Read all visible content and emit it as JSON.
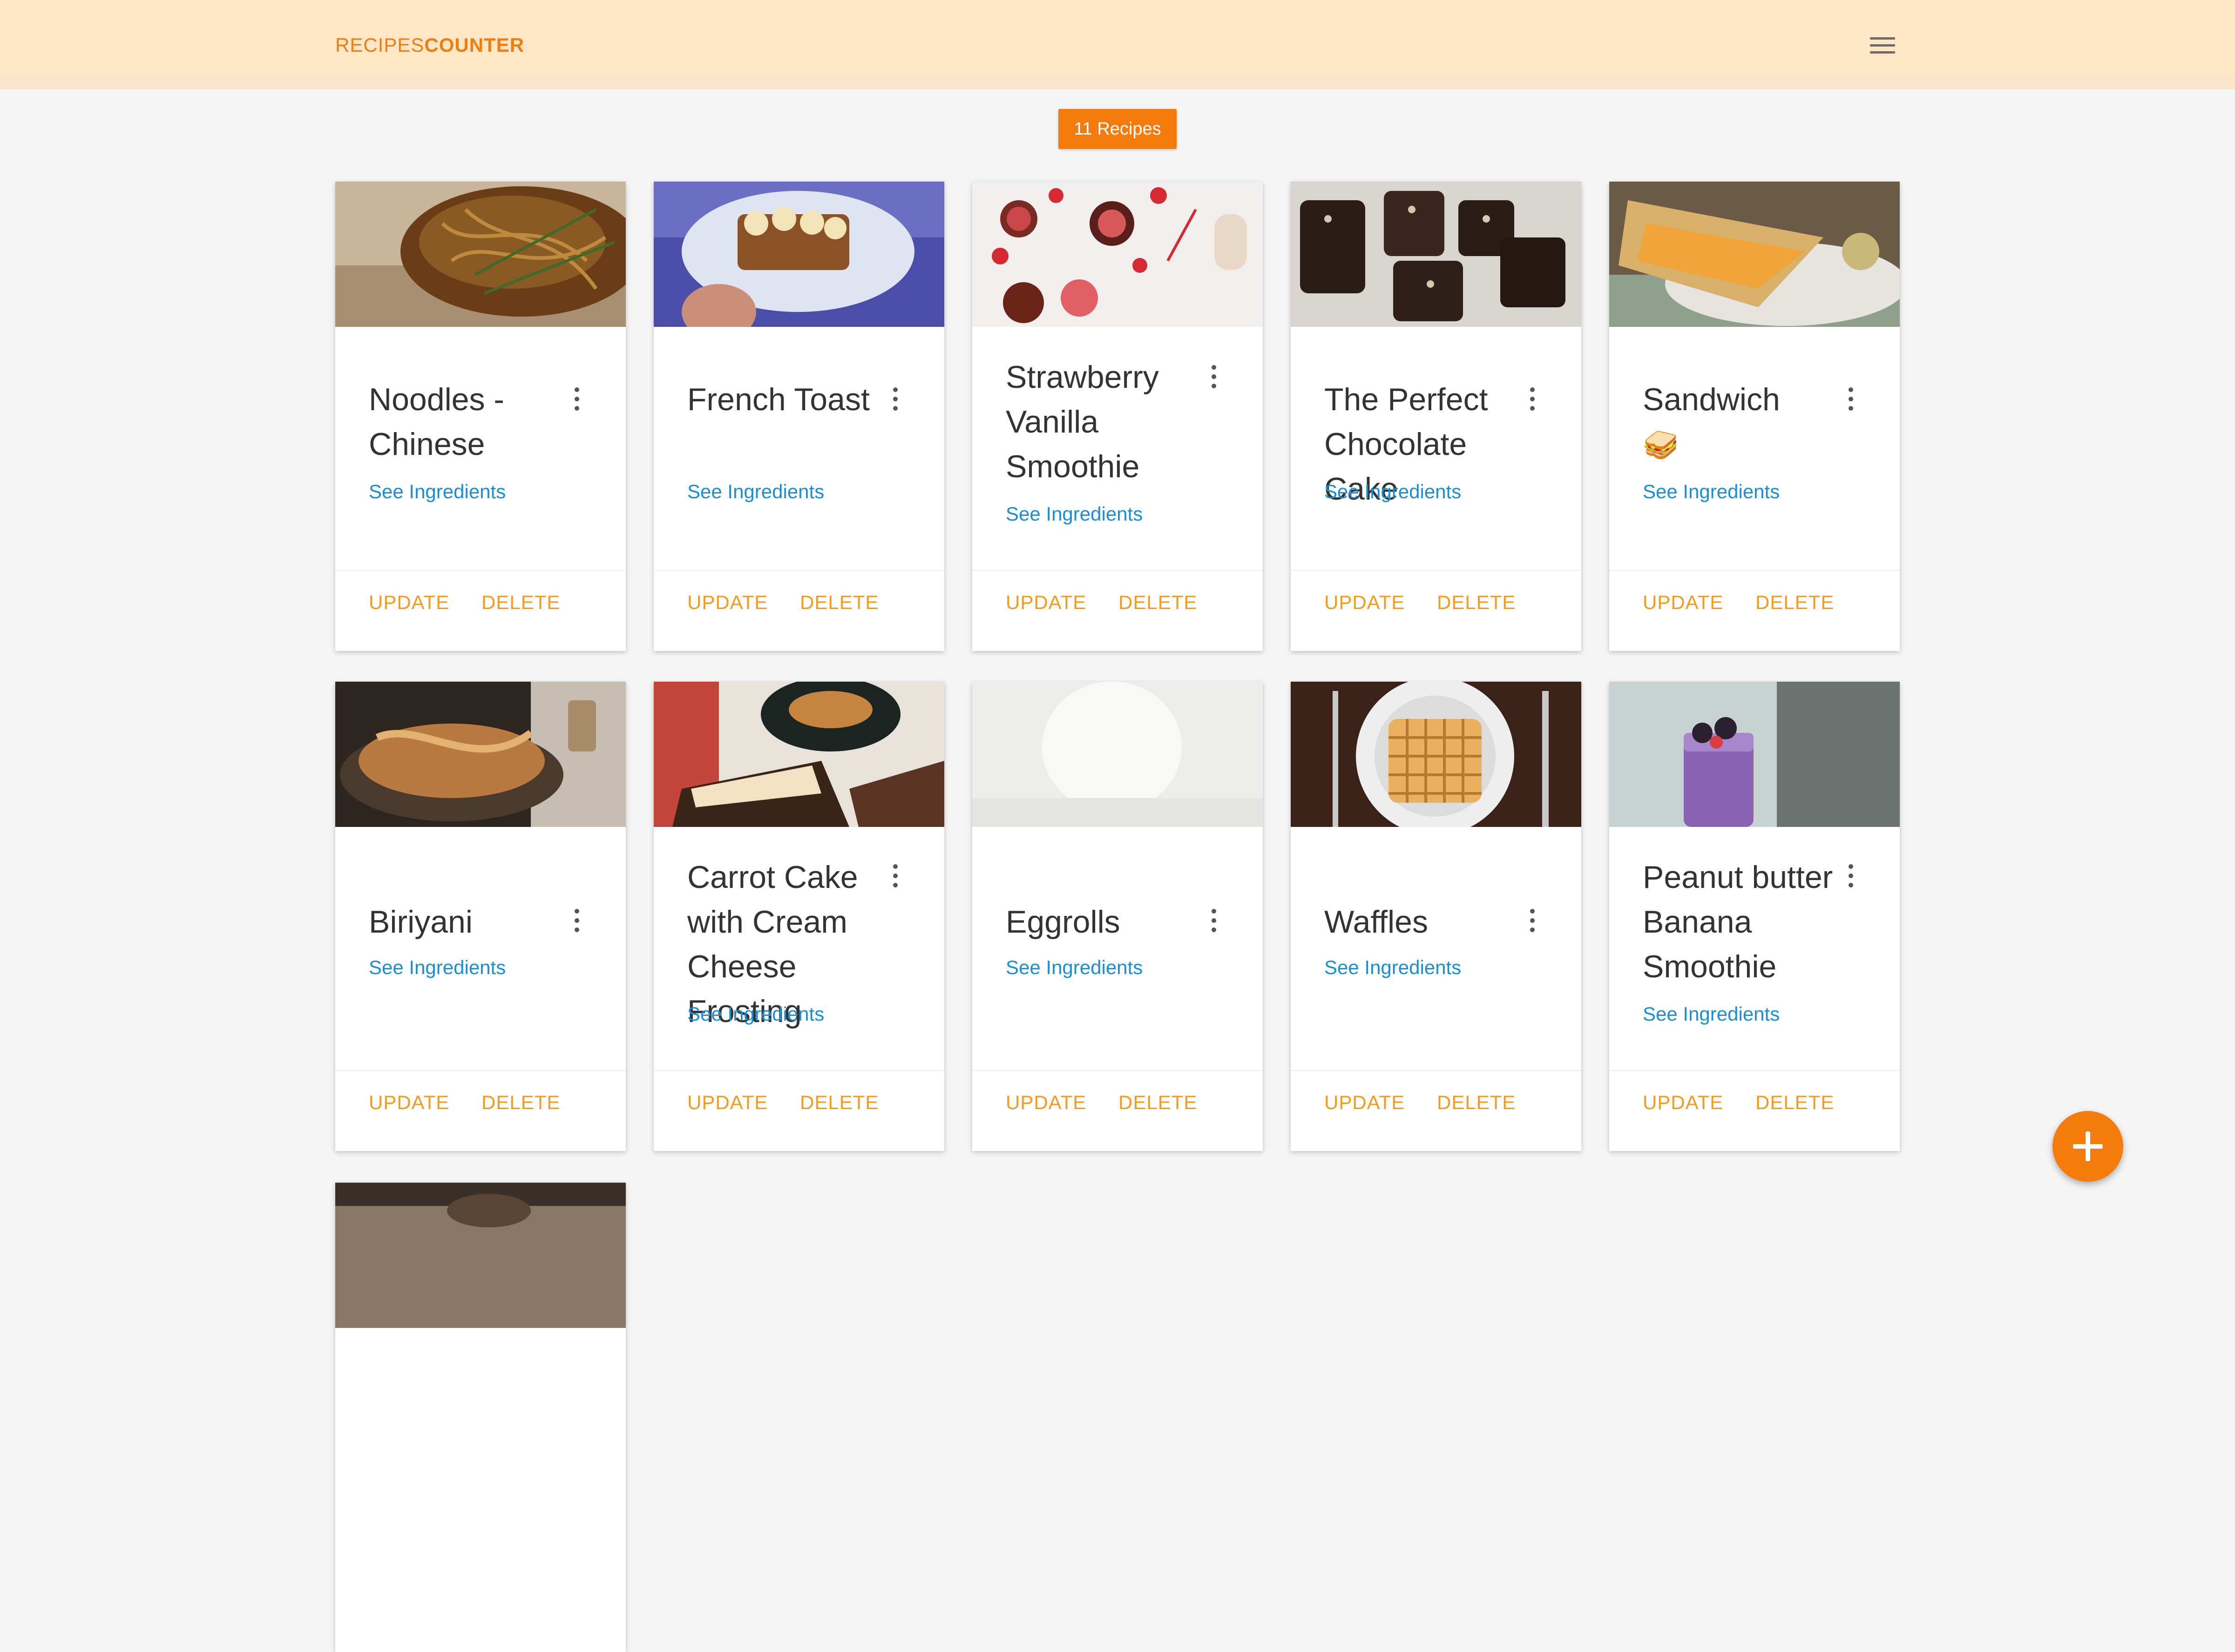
{
  "brand": {
    "part1": "RECIPES",
    "part2": "COUNTER"
  },
  "count_badge": "11 Recipes",
  "colors": {
    "accent": "#f57c0c",
    "nav_bg": "#ffe6c6",
    "link": "#1a8fd6",
    "action": "#f59a1c"
  },
  "icons": {
    "menu": "hamburger-menu-icon",
    "card_menu": "more-vert-icon",
    "add": "plus-icon"
  },
  "cards": [
    {
      "title": "Noodles - Chinese",
      "image": "noodles-photo",
      "link": "See Ingredients",
      "update": "UPDATE",
      "delete": "DELETE"
    },
    {
      "title": "French Toast",
      "image": "french-toast-photo",
      "link": "See Ingredients",
      "update": "UPDATE",
      "delete": "DELETE"
    },
    {
      "title": "Strawberry Vanilla Smoothie",
      "image": "strawberry-smoothie-photo",
      "link": "See Ingredients",
      "update": "UPDATE",
      "delete": "DELETE"
    },
    {
      "title": "The Perfect Chocolate Cake",
      "image": "chocolate-cake-photo",
      "link": "See Ingredients",
      "update": "UPDATE",
      "delete": "DELETE"
    },
    {
      "title": "Sandwich",
      "emoji": "🥪",
      "image": "sandwich-photo",
      "link": "See Ingredients",
      "update": "UPDATE",
      "delete": "DELETE"
    },
    {
      "title": "Biriyani",
      "image": "biriyani-photo",
      "link": "See Ingredients",
      "update": "UPDATE",
      "delete": "DELETE"
    },
    {
      "title": "Carrot Cake with Cream Cheese Frosting",
      "image": "carrot-cake-photo",
      "link": "See Ingredients",
      "update": "UPDATE",
      "delete": "DELETE"
    },
    {
      "title": "Eggrolls",
      "image": "eggrolls-photo",
      "link": "See Ingredients",
      "update": "UPDATE",
      "delete": "DELETE"
    },
    {
      "title": "Waffles",
      "image": "waffles-photo",
      "link": "See Ingredients",
      "update": "UPDATE",
      "delete": "DELETE"
    },
    {
      "title": "Peanut butter Banana Smoothie",
      "image": "peanut-butter-smoothie-photo",
      "link": "See Ingredients",
      "update": "UPDATE",
      "delete": "DELETE"
    },
    {
      "image": "wooden-table-photo"
    }
  ]
}
